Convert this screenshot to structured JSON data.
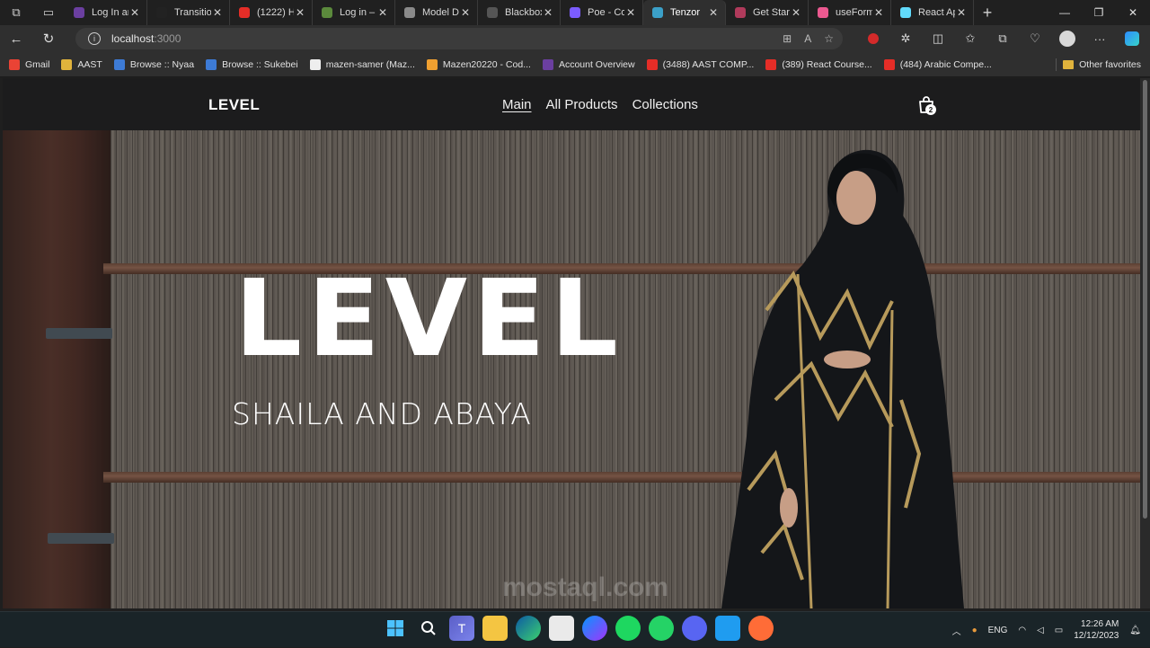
{
  "browser": {
    "tabs": [
      {
        "title": "Log In ar",
        "color": "#6b3fa0"
      },
      {
        "title": "Transition",
        "color": "#222222"
      },
      {
        "title": "(1222) H",
        "color": "#e52d27"
      },
      {
        "title": "Log in –",
        "color": "#5b8a3c"
      },
      {
        "title": "Model D",
        "color": "#8a8a8a"
      },
      {
        "title": "Blackbox",
        "color": "#555555"
      },
      {
        "title": "Poe - Co",
        "color": "#7b5cff"
      },
      {
        "title": "Tenzor",
        "color": "#3ba0c8",
        "active": true
      },
      {
        "title": "Get Start",
        "color": "#b03a5b"
      },
      {
        "title": "useForm",
        "color": "#ec5990"
      },
      {
        "title": "React Ap",
        "color": "#61dafb"
      }
    ],
    "address": {
      "host": "localhost",
      "port": ":3000"
    },
    "bookmarks": [
      {
        "label": "Gmail",
        "color": "#ea4335"
      },
      {
        "label": "AAST",
        "color": "#e0b33c"
      },
      {
        "label": "Browse :: Nyaa",
        "color": "#3d7bd6"
      },
      {
        "label": "Browse :: Sukebei",
        "color": "#3d7bd6"
      },
      {
        "label": "mazen-samer (Maz...",
        "color": "#eeeeee"
      },
      {
        "label": "Mazen20220 - Cod...",
        "color": "#f0a030"
      },
      {
        "label": "Account Overview",
        "color": "#6b3fa0"
      },
      {
        "label": "(3488) AAST COMP...",
        "color": "#e52d27"
      },
      {
        "label": "(389) React Course...",
        "color": "#e52d27"
      },
      {
        "label": "(484) Arabic Compe...",
        "color": "#e52d27"
      }
    ],
    "other_favorites": "Other favorites"
  },
  "site": {
    "logo": "LEVEL",
    "nav": [
      {
        "label": "Main",
        "current": true
      },
      {
        "label": "All Products"
      },
      {
        "label": "Collections"
      }
    ],
    "cart_count": "2",
    "hero": {
      "title": "LEVEL",
      "subtitle": "SHAILA AND ABAYA"
    },
    "watermark": "mostaql.com"
  },
  "taskbar": {
    "apps": [
      "windows-start",
      "search",
      "teams",
      "file-explorer",
      "edge",
      "store",
      "messenger",
      "spotify",
      "whatsapp",
      "discord",
      "vscode",
      "postman"
    ],
    "language": "ENG",
    "time": "12:26 AM",
    "date": "12/12/2023"
  },
  "colors": {
    "header_bg": "#1c1c1d",
    "taskbar_bg": "#1a2428",
    "accent": "#ffffff"
  }
}
